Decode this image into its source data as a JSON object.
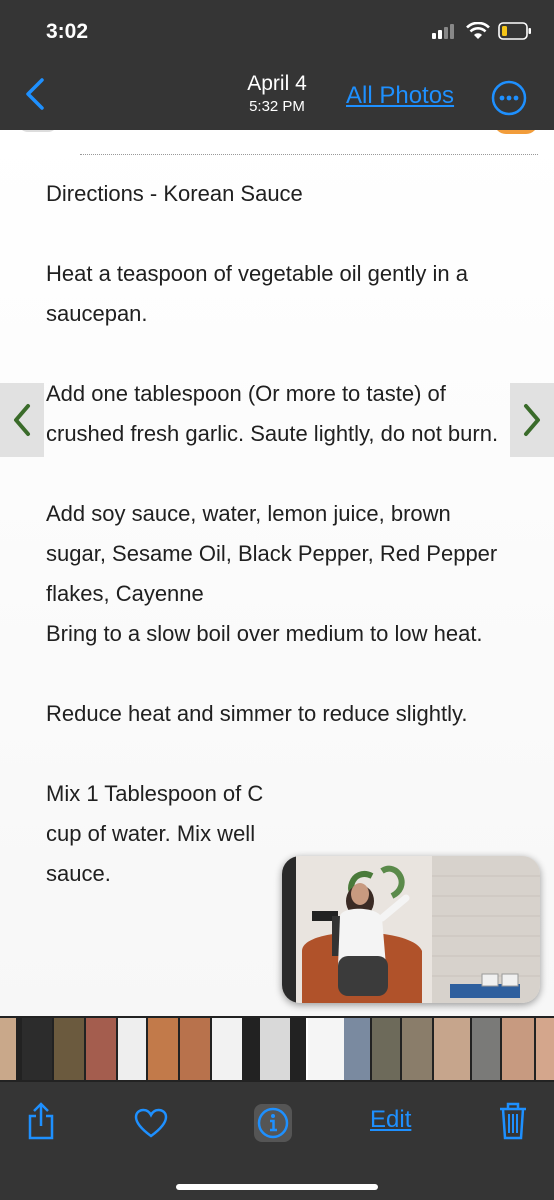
{
  "status": {
    "time": "3:02"
  },
  "nav": {
    "date": "April 4",
    "time": "5:32 PM",
    "all_photos": "All Photos"
  },
  "recipe": {
    "title": "Directions - Korean Sauce",
    "p1": "Heat a teaspoon of vegetable oil gently in a saucepan.",
    "p2": "Add one tablespoon (Or more to taste) of crushed fresh garlic. Saute lightly, do not burn.",
    "p3a": "Add soy sauce, water, lemon juice, brown sugar, Sesame Oil, Black Pepper, Red Pepper flakes, Cayenne",
    "p3b": "Bring to a slow boil over medium to low heat.",
    "p4": "Reduce heat and simmer to reduce slightly.",
    "p5": "Mix 1 Tablespoon of C",
    "p5b": "cup of water. Mix well",
    "p5c": "sauce."
  },
  "toolbar": {
    "edit_label": "Edit"
  },
  "icons": {
    "back": "chevron-left-icon",
    "more": "ellipsis-circle-icon",
    "share": "share-icon",
    "favorite": "heart-icon",
    "info": "info-icon",
    "delete": "trash-icon"
  },
  "colors": {
    "accent": "#1e90ff",
    "bar": "#353535",
    "arrow": "#3a6b2a"
  }
}
